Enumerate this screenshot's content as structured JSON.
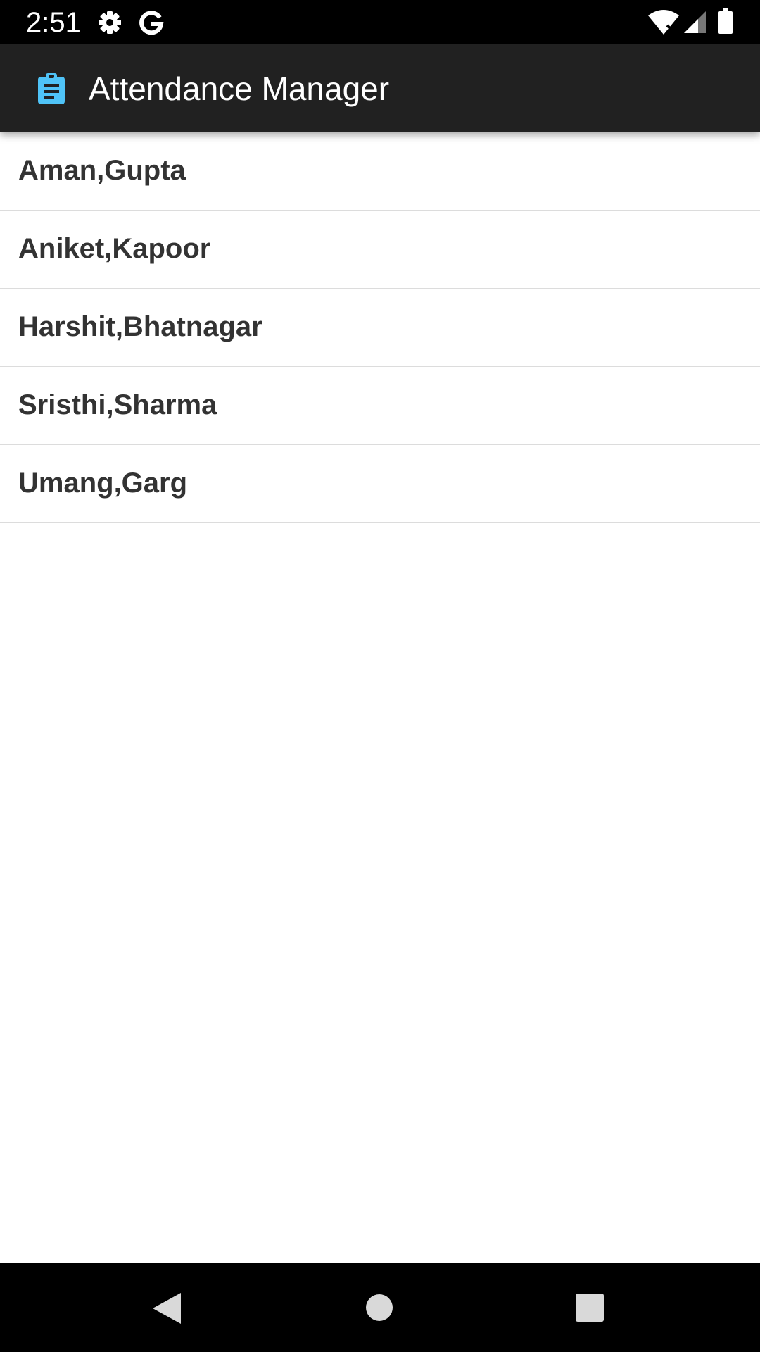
{
  "status_bar": {
    "time": "2:51",
    "icons": [
      "gear-icon",
      "google-g-icon",
      "wifi-icon",
      "cellular-signal-icon",
      "battery-icon"
    ]
  },
  "app_bar": {
    "title": "Attendance Manager",
    "icon": "clipboard-icon",
    "icon_color": "#4FC3F7"
  },
  "students": [
    {
      "name": "Aman,Gupta"
    },
    {
      "name": "Aniket,Kapoor"
    },
    {
      "name": "Harshit,Bhatnagar"
    },
    {
      "name": "Sristhi,Sharma"
    },
    {
      "name": "Umang,Garg"
    }
  ],
  "nav_bar": {
    "buttons": [
      "back-icon",
      "home-icon",
      "recents-icon"
    ]
  }
}
